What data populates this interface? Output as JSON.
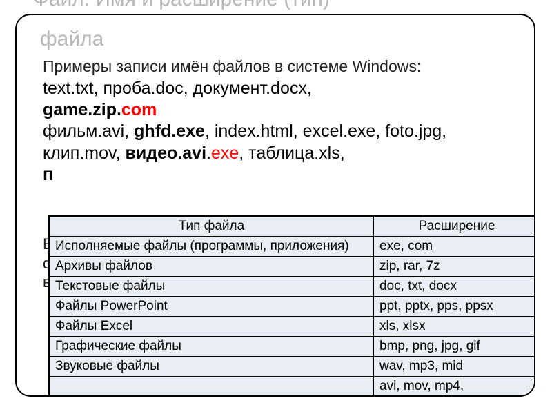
{
  "title_line1": "Файл. Имя и расширение (тип)",
  "title_line2": "файла",
  "intro": "Примеры записи имён файлов в системе Windows:",
  "line1_a": "text.txt, проба.doc, документ.docx,",
  "line2_b": "game.zip.",
  "line2_red": "com",
  "line3_a": "фильм.avi, ",
  "line3_b": "ghfd.exe",
  "line3_c": ", index.html, excel.exe, foto.jpg,",
  "line4_a": "клип.mov, ",
  "line4_b": "видео.avi",
  "line4_c": ".",
  "line4_red": "exe",
  "line4_d": ", таблица.xls,",
  "line5_pre": "п",
  "hint_l1": "Е",
  "hint_l2": "ф",
  "hint_l3": "в",
  "table": {
    "headers": [
      "Тип файла",
      "Расширение"
    ],
    "rows": [
      [
        "Исполняемые файлы (программы, приложения)",
        "exe, com"
      ],
      [
        "Архивы файлов",
        "zip, rar, 7z"
      ],
      [
        "Текстовые файлы",
        "doc, txt, docx"
      ],
      [
        "Файлы PowerPoint",
        "ppt, pptx, pps, ppsx"
      ],
      [
        "Файлы Excel",
        "xls, xlsx"
      ],
      [
        "Графические файлы",
        "bmp, png, jpg, gif"
      ],
      [
        "Звуковые файлы",
        "wav, mp3, mid"
      ],
      [
        "",
        "avi, mov, mp4,"
      ]
    ]
  }
}
